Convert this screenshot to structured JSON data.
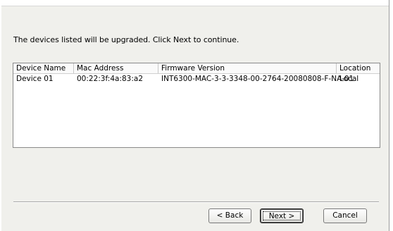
{
  "instruction": "The devices listed will be upgraded. Click Next to continue.",
  "list": {
    "columns": [
      "Device Name",
      "Mac Address",
      "Firmware Version",
      "Location"
    ],
    "rows": [
      [
        "Device 01",
        "00:22:3f:4a:83:a2",
        "INT6300-MAC-3-3-3348-00-2764-20080808-F-NA-01",
        "Local"
      ]
    ]
  },
  "buttons": {
    "back": "< Back",
    "next": "Next >",
    "cancel": "Cancel"
  }
}
